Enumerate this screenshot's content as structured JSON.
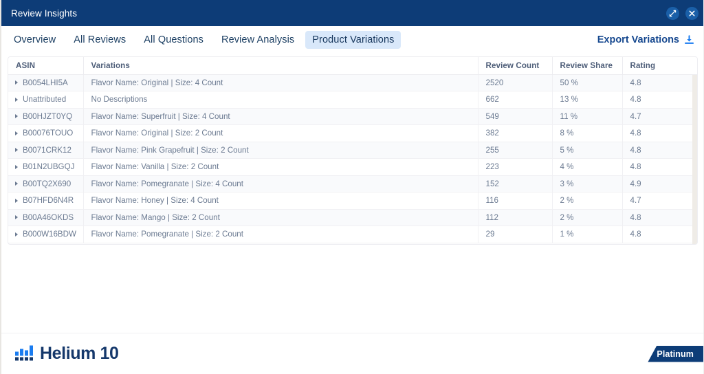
{
  "window": {
    "title": "Review Insights",
    "expand_icon": "expand-diagonal-icon",
    "close_icon": "close-icon"
  },
  "tabs": [
    {
      "label": "Overview",
      "active": false
    },
    {
      "label": "All Reviews",
      "active": false
    },
    {
      "label": "All Questions",
      "active": false
    },
    {
      "label": "Review Analysis",
      "active": false
    },
    {
      "label": "Product Variations",
      "active": true
    }
  ],
  "toolbar": {
    "export_label": "Export Variations",
    "export_icon": "download-icon"
  },
  "table": {
    "columns": [
      "ASIN",
      "Variations",
      "Review Count",
      "Review Share",
      "Rating"
    ],
    "rows": [
      {
        "asin": "B0054LHI5A",
        "variations": "Flavor Name: Original | Size: 4 Count",
        "review_count": "2520",
        "review_share": "50 %",
        "rating": "4.8"
      },
      {
        "asin": "Unattributed",
        "variations": "No Descriptions",
        "review_count": "662",
        "review_share": "13 %",
        "rating": "4.8"
      },
      {
        "asin": "B00HJZT0YQ",
        "variations": "Flavor Name: Superfruit | Size: 4 Count",
        "review_count": "549",
        "review_share": "11 %",
        "rating": "4.7"
      },
      {
        "asin": "B00076TOUO",
        "variations": "Flavor Name: Original | Size: 2 Count",
        "review_count": "382",
        "review_share": "8 %",
        "rating": "4.8"
      },
      {
        "asin": "B0071CRK12",
        "variations": "Flavor Name: Pink Grapefruit | Size: 2 Count",
        "review_count": "255",
        "review_share": "5 %",
        "rating": "4.8"
      },
      {
        "asin": "B01N2UBGQJ",
        "variations": "Flavor Name: Vanilla | Size: 2 Count",
        "review_count": "223",
        "review_share": "4 %",
        "rating": "4.8"
      },
      {
        "asin": "B00TQ2X690",
        "variations": "Flavor Name: Pomegranate | Size: 4 Count",
        "review_count": "152",
        "review_share": "3 %",
        "rating": "4.9"
      },
      {
        "asin": "B07HFD6N4R",
        "variations": "Flavor Name: Honey | Size: 4 Count",
        "review_count": "116",
        "review_share": "2 %",
        "rating": "4.7"
      },
      {
        "asin": "B00A46OKDS",
        "variations": "Flavor Name: Mango | Size: 2 Count",
        "review_count": "112",
        "review_share": "2 %",
        "rating": "4.8"
      },
      {
        "asin": "B000W16BDW",
        "variations": "Flavor Name: Pomegranate | Size: 2 Count",
        "review_count": "29",
        "review_share": "1 %",
        "rating": "4.8"
      }
    ]
  },
  "footer": {
    "logo_text": "Helium 10",
    "logo_icon": "bar-chart-logo-icon",
    "plan_badge": "Platinum"
  },
  "colors": {
    "titlebar_bg": "#0d3c77",
    "tab_active_bg": "#d9e8fa",
    "accent_blue": "#16488f",
    "logo_blue": "#15386b",
    "icon_blue": "#1a7cf0",
    "row_alt_bg": "#f9fafc",
    "text_muted": "#6b7a91"
  }
}
